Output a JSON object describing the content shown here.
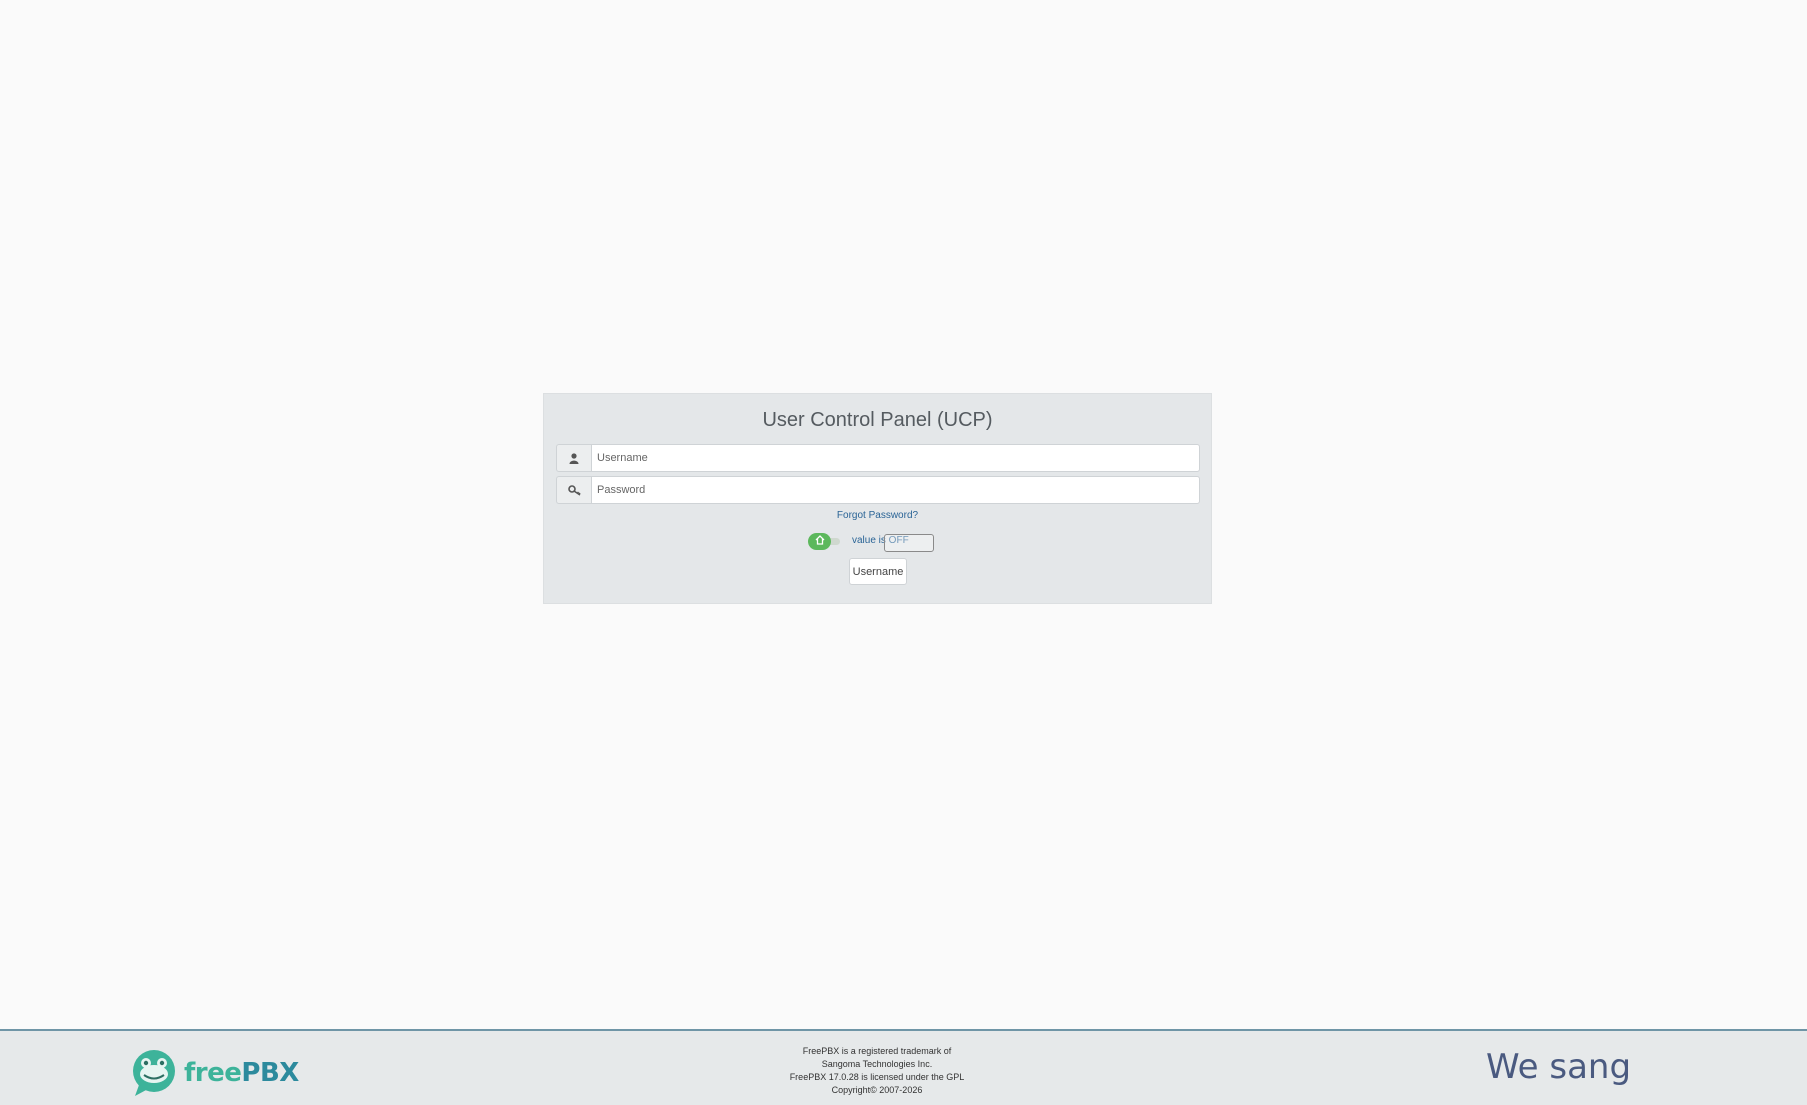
{
  "login": {
    "title": "User Control Panel (UCP)",
    "username_placeholder": "Username",
    "password_placeholder": "Password",
    "forgot_password": "Forgot Password?",
    "toggle_status": "value is OFF",
    "login_button": "Username"
  },
  "icons": {
    "username": "user-icon",
    "password": "key-icon",
    "toggle": "house-icon"
  },
  "footer": {
    "logo": {
      "free": "free",
      "pbx": "PBX"
    },
    "info": [
      "FreePBX is a registered trademark of",
      "Sangoma Technologies Inc.",
      "FreePBX 17.0.28 is licensed under the GPL",
      "Copyright© 2007-2026"
    ],
    "brand": "We sang"
  },
  "colors": {
    "panel_bg": "#e4e7e9",
    "link": "#2a6496",
    "toggle_on": "#5cb85c",
    "footer_border": "#6f95a6",
    "logo_green": "#3db39a",
    "logo_teal": "#2c8a9d",
    "brand": "#4a5a80"
  }
}
